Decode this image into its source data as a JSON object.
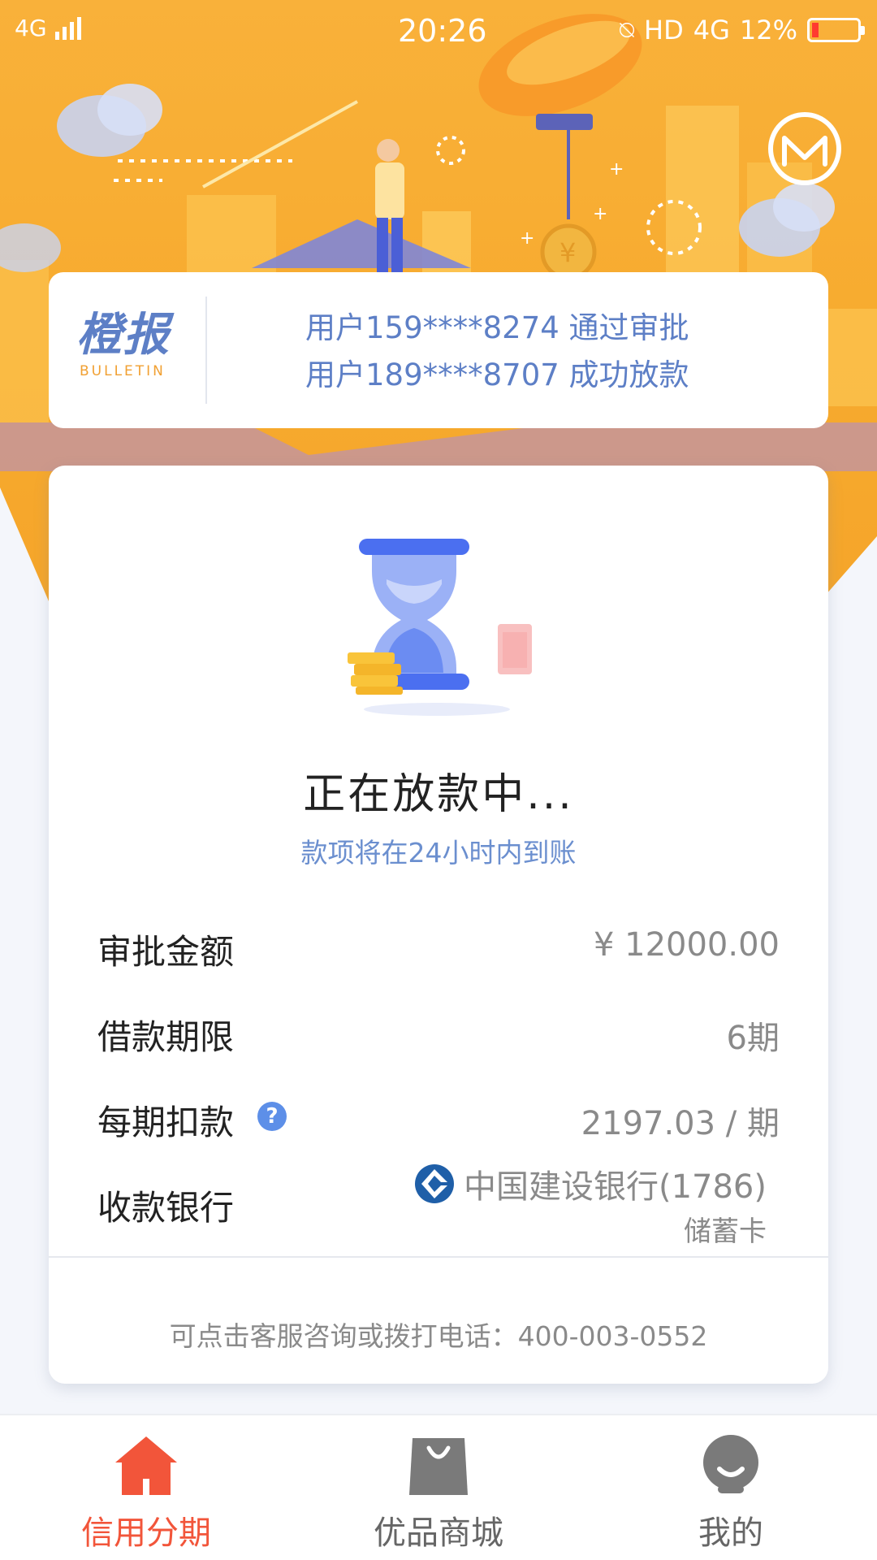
{
  "status_bar": {
    "network": "4G",
    "time": "20:26",
    "hd": "HD",
    "net2": "4G",
    "battery": "12%"
  },
  "bulletin": {
    "logo_cn": "橙报",
    "logo_en": "BULLETIN",
    "items": [
      "用户159****8274 通过审批",
      "用户189****8707 成功放款"
    ]
  },
  "status": {
    "title": "正在放款中...",
    "subtitle": "款项将在24小时内到账"
  },
  "details": {
    "amount": {
      "label": "审批金额",
      "value": "¥ 12000.00"
    },
    "term": {
      "label": "借款期限",
      "value": "6期"
    },
    "installment": {
      "label": "每期扣款",
      "value": "2197.03 / 期",
      "help": "?"
    },
    "bank": {
      "label": "收款银行",
      "name": "中国建设银行(1786)",
      "card_type": "储蓄卡"
    }
  },
  "service_text": "可点击客服咨询或拨打电话：400-003-0552",
  "nav": [
    {
      "label": "信用分期",
      "active": true
    },
    {
      "label": "优品商城",
      "active": false
    },
    {
      "label": "我的",
      "active": false
    }
  ],
  "colors": {
    "accent_orange": "#f5a52a",
    "nav_active": "#f2553a",
    "nav_inactive": "#666666",
    "bulletin_blue": "#5d7fc6",
    "hourglass_blue": "#4b6ff0"
  }
}
